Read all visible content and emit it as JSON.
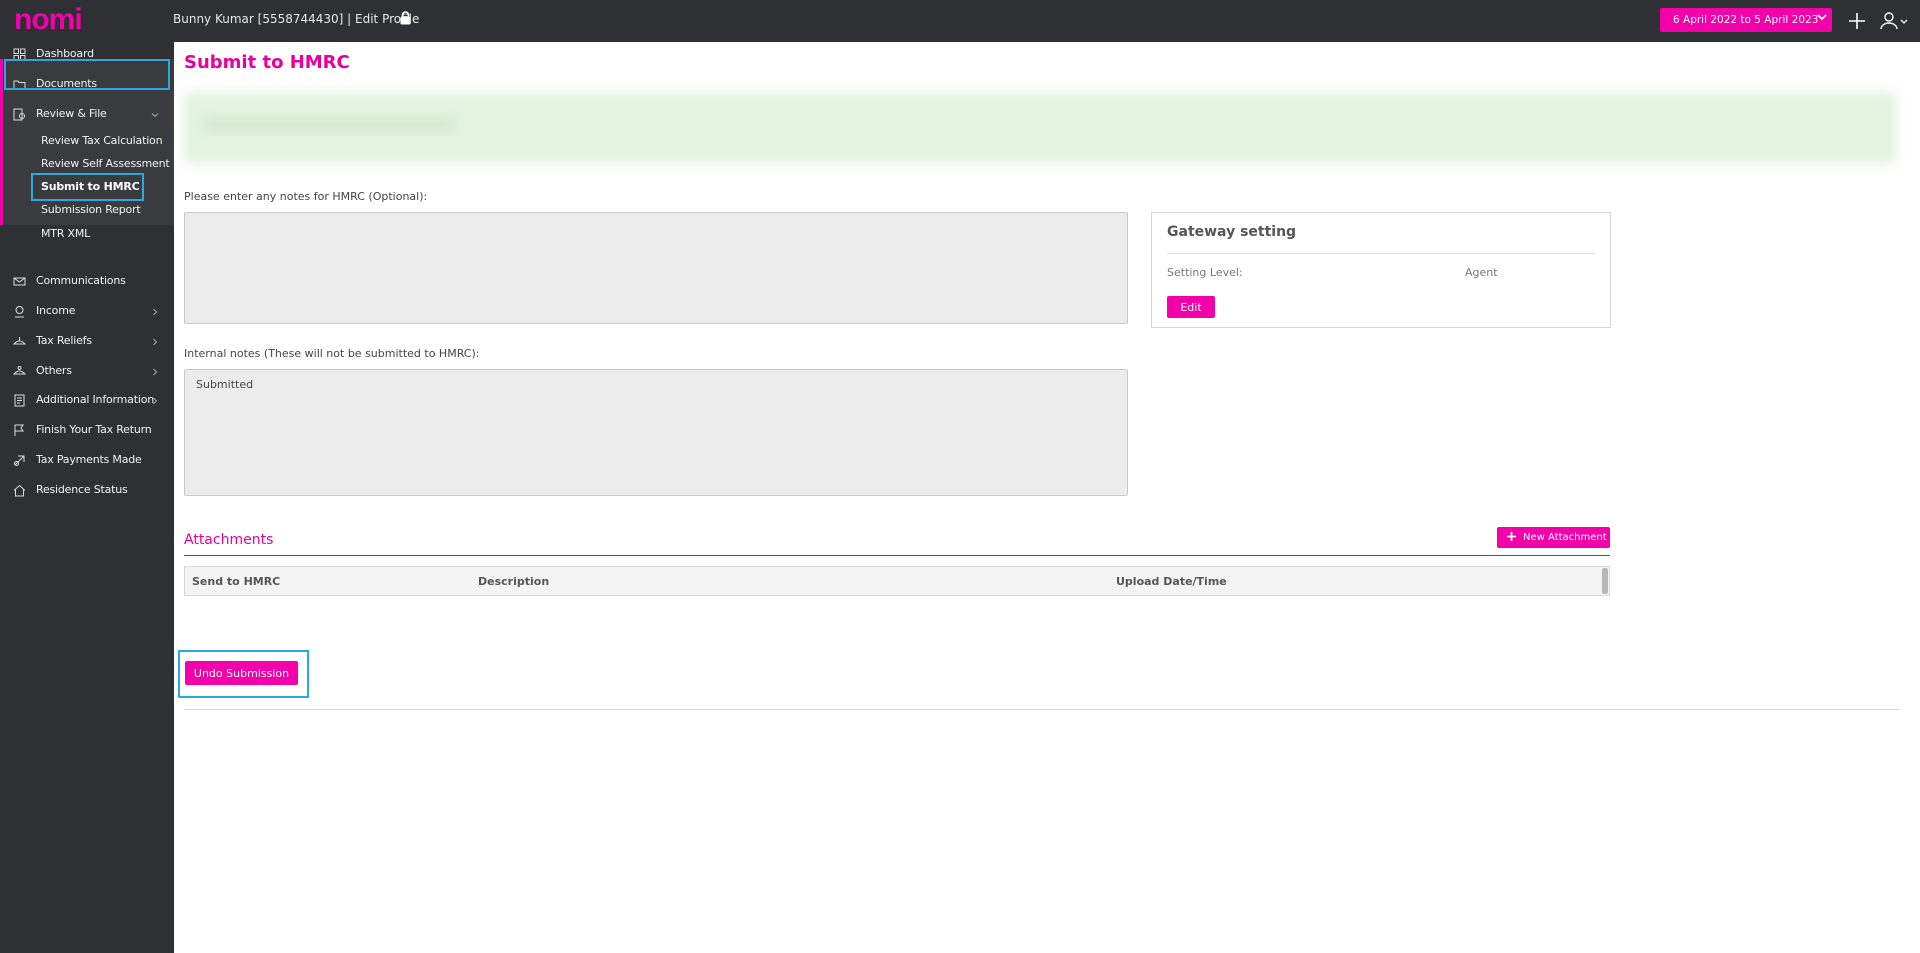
{
  "header": {
    "logo_text": "nomi",
    "user_title": "Bunny Kumar [5558744430] | Edit Profile",
    "date_range": "6 April 2022 to 5 April 2023",
    "brand_color": "#f200a9"
  },
  "sidebar": {
    "items": [
      {
        "label": "Dashboard",
        "icon": "dashboard-icon"
      },
      {
        "label": "Documents",
        "icon": "folder-icon"
      },
      {
        "label": "Review & File",
        "icon": "review-icon"
      },
      {
        "label": "Communications",
        "icon": "communications-icon"
      },
      {
        "label": "Income",
        "icon": "income-icon"
      },
      {
        "label": "Tax Reliefs",
        "icon": "tax-reliefs-icon"
      },
      {
        "label": "Others",
        "icon": "others-icon"
      },
      {
        "label": "Additional Information",
        "icon": "additional-info-icon"
      },
      {
        "label": "Finish Your Tax Return",
        "icon": "flag-icon"
      },
      {
        "label": "Tax Payments Made",
        "icon": "payments-icon"
      },
      {
        "label": "Residence Status",
        "icon": "home-icon"
      }
    ],
    "review_sub_items": [
      {
        "label": "Review Tax Calculation"
      },
      {
        "label": "Review Self Assessment"
      },
      {
        "label": "Submit to HMRC"
      },
      {
        "label": "Submission Report"
      },
      {
        "label": "MTR XML"
      }
    ]
  },
  "main": {
    "title": "Submit to HMRC",
    "hmrc_notes_label": "Please enter any notes for HMRC (Optional):",
    "hmrc_notes_value": "",
    "internal_notes_label": "Internal notes (These will not be submitted to HMRC):",
    "internal_notes_value": "Submitted",
    "gateway": {
      "title": "Gateway setting",
      "setting_level_label": "Setting Level:",
      "setting_level_value": "Agent",
      "edit_label": "Edit"
    },
    "attachments": {
      "title": "Attachments",
      "new_button_label": "New Attachment",
      "columns": [
        "Send to HMRC",
        "Description",
        "Upload Date/Time"
      ]
    },
    "undo_label": "Undo Submission"
  }
}
